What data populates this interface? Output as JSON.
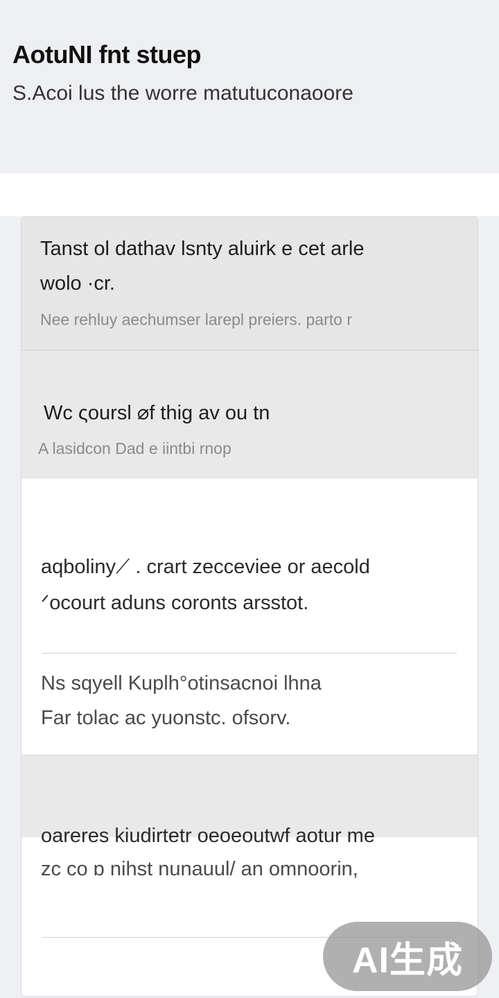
{
  "header": {
    "title": "AotuNI fnt stuep",
    "subtitle": "S.Acoi lus the worre matutuconaoore"
  },
  "list": {
    "items": [
      {
        "title_line1": "Tanst ol dathav lsnty aluirk e cet arle",
        "title_line2": "wolo ·cr.",
        "subtitle": "Nee rehluy aechumser larepl preiers. parto r"
      },
      {
        "title": "Wc ςoursl ⌀f thig av ou tn",
        "subtitle": "A lasidcon Dad e iintbi rnop"
      },
      {
        "line1": "aqboliny⟋ . crart zecceviee or aecold",
        "line2": "ᐟocourt aduns coronts arsstot.",
        "line3": "Ns sqyell Kuplh°otinsacnoi lhna",
        "line4": "Far tolac ac yuonstc. ofsorv."
      },
      {
        "line1": "oareres kiudirtetr oeoeoutwf aotur me",
        "line2": "zc co ɒ nihst nunauul/ an omnoorin,"
      }
    ]
  },
  "watermark": {
    "text": "AI生成"
  }
}
